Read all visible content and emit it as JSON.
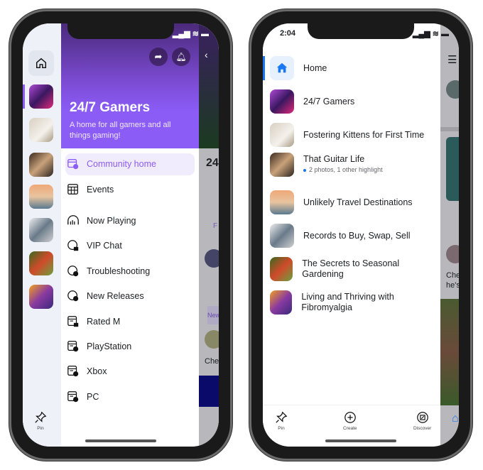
{
  "left_phone": {
    "community": {
      "title": "24/7 Gamers",
      "description": "A home for all gamers and all things gaming!",
      "accent": "#8b5cf6"
    },
    "menu": [
      {
        "label": "Community home",
        "icon": "community-home-icon",
        "selected": true
      },
      {
        "label": "Events",
        "icon": "calendar-icon"
      },
      {
        "label": "Now Playing",
        "icon": "audio-channel-icon"
      },
      {
        "label": "VIP Chat",
        "icon": "chat-lock-icon"
      },
      {
        "label": "Troubleshooting",
        "icon": "chat-globe-icon"
      },
      {
        "label": "New Releases",
        "icon": "chat-globe-icon"
      },
      {
        "label": "Rated M",
        "icon": "forum-lock-icon"
      },
      {
        "label": "PlayStation",
        "icon": "forum-globe-icon"
      },
      {
        "label": "Xbox",
        "icon": "forum-globe-icon"
      },
      {
        "label": "PC",
        "icon": "forum-globe-icon"
      }
    ],
    "rail_bottom": {
      "label": "Pin",
      "icon": "pin-icon"
    },
    "peek": {
      "title": "24",
      "tag": "F",
      "section": "New",
      "comment": "Che"
    }
  },
  "right_phone": {
    "status_time": "2:04",
    "communities": [
      {
        "name": "Home",
        "icon": "home-icon",
        "selected": true
      },
      {
        "name": "24/7 Gamers"
      },
      {
        "name": "Fostering Kittens for First Time"
      },
      {
        "name": "That Guitar Life",
        "sub": "2 photos, 1 other highlight"
      },
      {
        "name": "Unlikely Travel Destinations"
      },
      {
        "name": "Records to Buy, Swap, Sell"
      },
      {
        "name": "The Secrets to Seasonal Gardening"
      },
      {
        "name": "Living and Thriving with Fibromyalgia"
      }
    ],
    "tabs": [
      {
        "label": "Pin",
        "icon": "pin-icon"
      },
      {
        "label": "Create",
        "icon": "plus-circle-icon"
      },
      {
        "label": "Discover",
        "icon": "discover-icon"
      }
    ],
    "peek": {
      "comment": "Che he's"
    },
    "accent": "#1877f2"
  }
}
